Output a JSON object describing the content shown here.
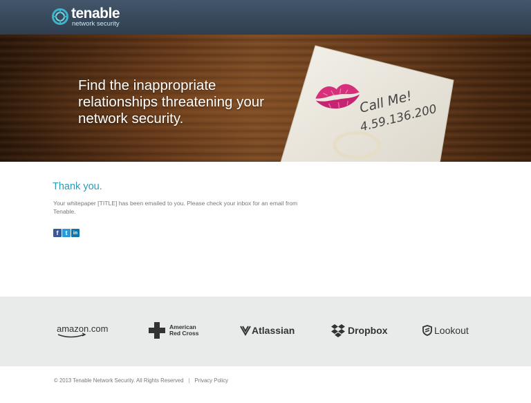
{
  "header": {
    "logo_name": "tenable",
    "logo_tagline": "network security",
    "accent_color": "#2a9bb5"
  },
  "hero": {
    "headline": "Find the inappropriate relationships threatening your network security.",
    "napkin_line1": "Call Me!",
    "napkin_line2": "4.59.136.200"
  },
  "content": {
    "title": "Thank you.",
    "message": "Your whitepaper [TITLE] has been emailed to you. Please check your inbox for an email from Tenable.",
    "share": [
      {
        "icon": "facebook-icon",
        "glyph": "f",
        "color": "#3b5998"
      },
      {
        "icon": "twitter-icon",
        "glyph": "t",
        "color": "#2a9bd4"
      },
      {
        "icon": "linkedin-icon",
        "glyph": "in",
        "color": "#0e76a8"
      }
    ]
  },
  "partners": {
    "amazon": "amazon.com",
    "red_cross_line1": "American",
    "red_cross_line2": "Red Cross",
    "atlassian": "Atlassian",
    "dropbox": "Dropbox",
    "lookout": "Lookout"
  },
  "footer": {
    "copyright": "© 2013 Tenable Network Security. All Rights Reserved",
    "separator": "|",
    "privacy_link": "Privacy Policy"
  }
}
